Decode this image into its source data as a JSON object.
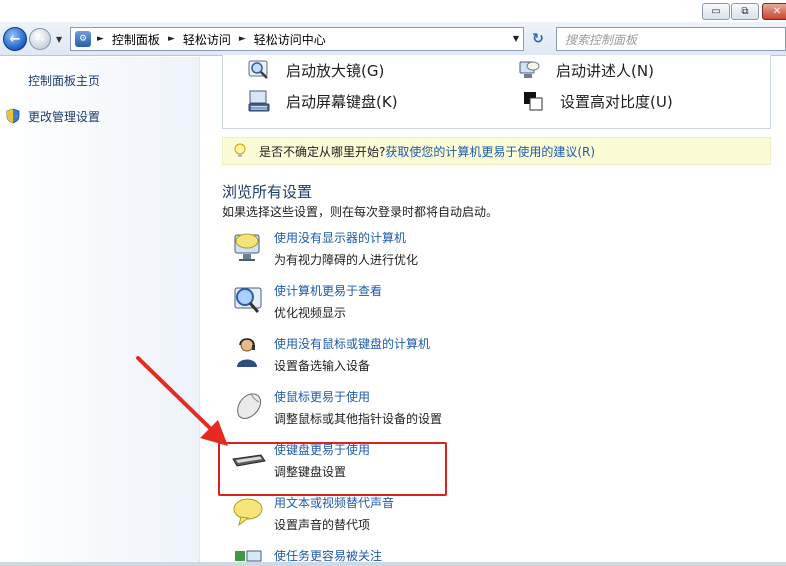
{
  "window": {
    "buttons": {
      "minimize": "▭",
      "maximize": "⧉",
      "close": "✕"
    }
  },
  "nav": {
    "back_icon": "back-arrow-icon",
    "forward_icon": "forward-arrow-icon",
    "breadcrumb": [
      "控制面板",
      "轻松访问",
      "轻松访问中心"
    ],
    "search_placeholder": "搜索控制面板"
  },
  "sidebar": {
    "items": [
      {
        "label": "控制面板主页"
      },
      {
        "label": "更改管理设置"
      }
    ]
  },
  "quick_access": {
    "items": [
      {
        "label": "启动放大镜(G)",
        "icon": "magnifier-icon"
      },
      {
        "label": "启动讲述人(N)",
        "icon": "narrator-icon"
      },
      {
        "label": "启动屏幕键盘(K)",
        "icon": "on-screen-keyboard-icon"
      },
      {
        "label": "设置高对比度(U)",
        "icon": "high-contrast-icon"
      }
    ]
  },
  "tip": {
    "text": "是否不确定从哪里开始?",
    "link": "获取使您的计算机更易于使用的建议(R)"
  },
  "browse": {
    "title": "浏览所有设置",
    "subtitle": "如果选择这些设置，则在每次登录时都将自动启动。",
    "items": [
      {
        "title": "使用没有显示器的计算机",
        "desc": "为有视力障碍的人进行优化",
        "icon": "monitor-speech-icon"
      },
      {
        "title": "使计算机更易于查看",
        "desc": "优化视频显示",
        "icon": "magnify-display-icon"
      },
      {
        "title": "使用没有鼠标或键盘的计算机",
        "desc": "设置备选输入设备",
        "icon": "person-headset-icon"
      },
      {
        "title": "使鼠标更易于使用",
        "desc": "调整鼠标或其他指针设备的设置",
        "icon": "mouse-icon"
      },
      {
        "title": "使键盘更易于使用",
        "desc": "调整键盘设置",
        "icon": "keyboard-icon"
      },
      {
        "title": "用文本或视频替代声音",
        "desc": "设置声音的替代项",
        "icon": "speech-bubble-icon"
      },
      {
        "title": "使任务更容易被关注",
        "desc": "",
        "icon": "task-focus-icon"
      }
    ]
  },
  "annotation": {
    "color": "#e0201e"
  }
}
